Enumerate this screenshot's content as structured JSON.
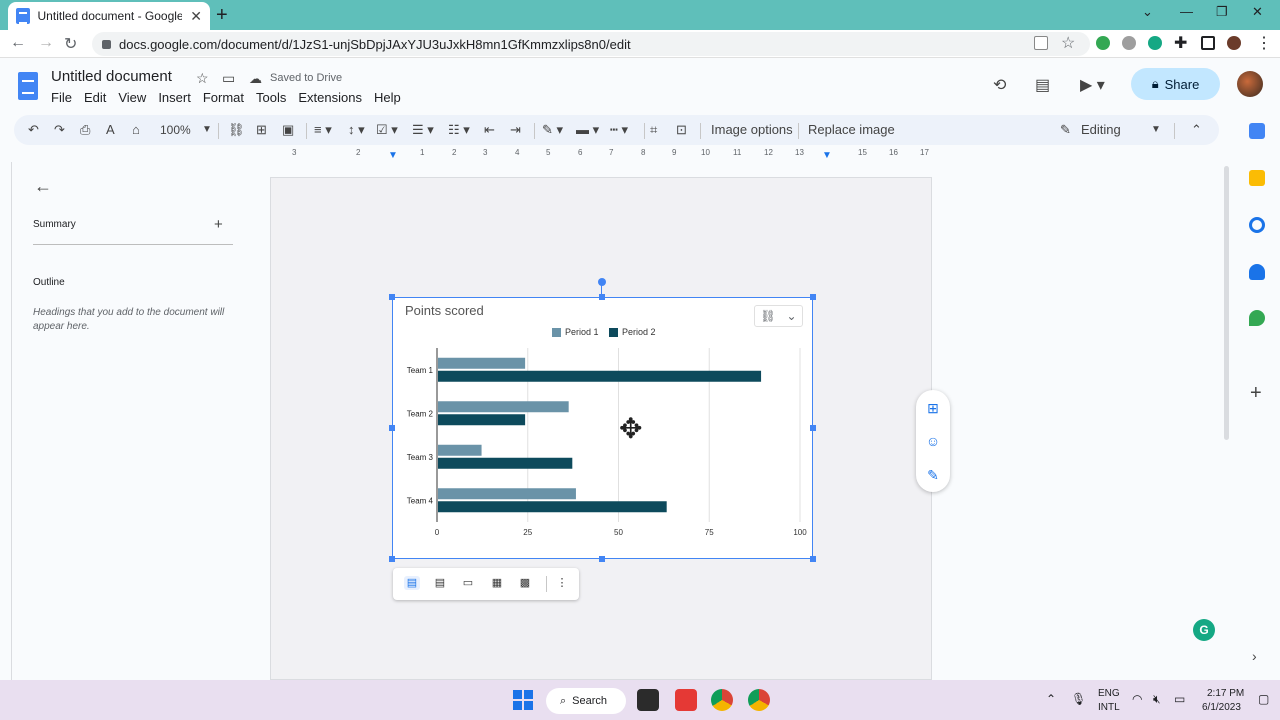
{
  "browser": {
    "tab_title": "Untitled document - Google Docs",
    "url": "docs.google.com/document/d/1JzS1-unjSbDpjJAxYJU3uJxkH8mn1GfKmmzxlips8n0/edit"
  },
  "docs": {
    "title": "Untitled document",
    "saved_status": "Saved to Drive",
    "menus": [
      "File",
      "Edit",
      "View",
      "Insert",
      "Format",
      "Tools",
      "Extensions",
      "Help"
    ],
    "share_label": "Share"
  },
  "toolbar": {
    "zoom": "100%",
    "image_options": "Image options",
    "replace_image": "Replace image",
    "mode": "Editing"
  },
  "ruler": {
    "marks": [
      "3",
      "2",
      "1",
      "1",
      "2",
      "3",
      "4",
      "5",
      "6",
      "7",
      "8",
      "9",
      "10",
      "11",
      "12",
      "13",
      "14",
      "15",
      "16",
      "17"
    ]
  },
  "outline_panel": {
    "summary_label": "Summary",
    "outline_label": "Outline",
    "hint": "Headings that you add to the document will appear here."
  },
  "chart_data": {
    "type": "bar",
    "orientation": "horizontal",
    "title": "Points scored",
    "categories": [
      "Team 1",
      "Team 2",
      "Team 3",
      "Team 4"
    ],
    "series": [
      {
        "name": "Period 1",
        "color": "#6a93a8",
        "values": [
          24,
          36,
          12,
          38
        ]
      },
      {
        "name": "Period 2",
        "color": "#0d4a5c",
        "values": [
          89,
          24,
          37,
          63
        ]
      }
    ],
    "xlim": [
      0,
      100
    ],
    "xticks": [
      "0",
      "25",
      "50",
      "75",
      "100"
    ],
    "legend_position": "top",
    "grid": true
  },
  "taskbar": {
    "search_label": "Search",
    "language": "ENG",
    "layout": "INTL",
    "time": "2:17 PM",
    "date": "6/1/2023"
  },
  "colors": {
    "tabstrip": "#5fbfba",
    "accent": "#1a73e8",
    "share_bg": "#c2e7ff"
  }
}
